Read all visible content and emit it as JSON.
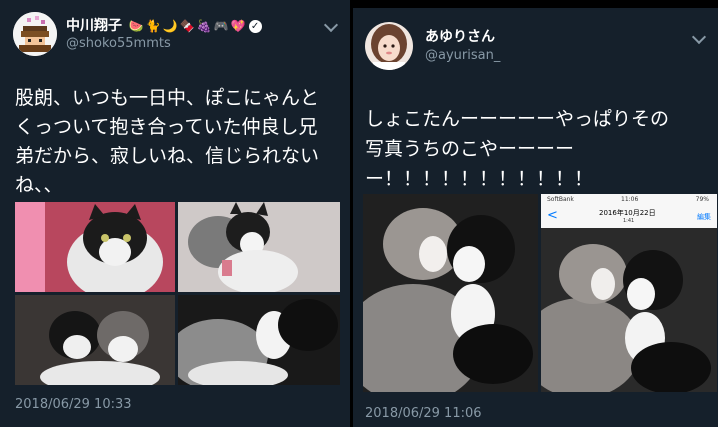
{
  "left_tweet": {
    "display_name": "中川翔子",
    "handle": "@shoko55mmts",
    "name_emoji": [
      "🍉",
      "🐈",
      "🌙",
      "🍫",
      "🍇",
      "🎮",
      "💖"
    ],
    "verified_glyph": "✓",
    "text_lines": [
      "股朗、いつも一日中、ぽこにゃんと",
      "くっついて抱き合っていた仲良し兄",
      "弟だから、寂しいね、信じられない",
      "ね、、"
    ],
    "timestamp": "2018/06/29 10:33",
    "photo_count": 4
  },
  "right_tweet": {
    "display_name": "あゆりさん",
    "handle": "@ayurisan_",
    "text_lines": [
      "しょこたんーーーーーやっぱりその",
      "写真うちのこやーーーー",
      "ー！！！！！！！！！！！"
    ],
    "timestamp": "2018/06/29 11:06",
    "photo_count": 2,
    "phone_screenshot": {
      "carrier": "SoftBank",
      "time": "11:06",
      "battery": "79%",
      "back_glyph": "<",
      "date_title": "2016年10月22日",
      "date_sub": "1:41",
      "edit_label": "編集"
    }
  },
  "icons": [
    "avatar-pixel-icon",
    "avatar-photo-icon",
    "verified-icon",
    "chevron-down-icon"
  ],
  "colors": {
    "background": "#15202b",
    "primary_text": "#ffffff",
    "secondary_text": "#8899a6",
    "ios_blue": "#007aff"
  }
}
